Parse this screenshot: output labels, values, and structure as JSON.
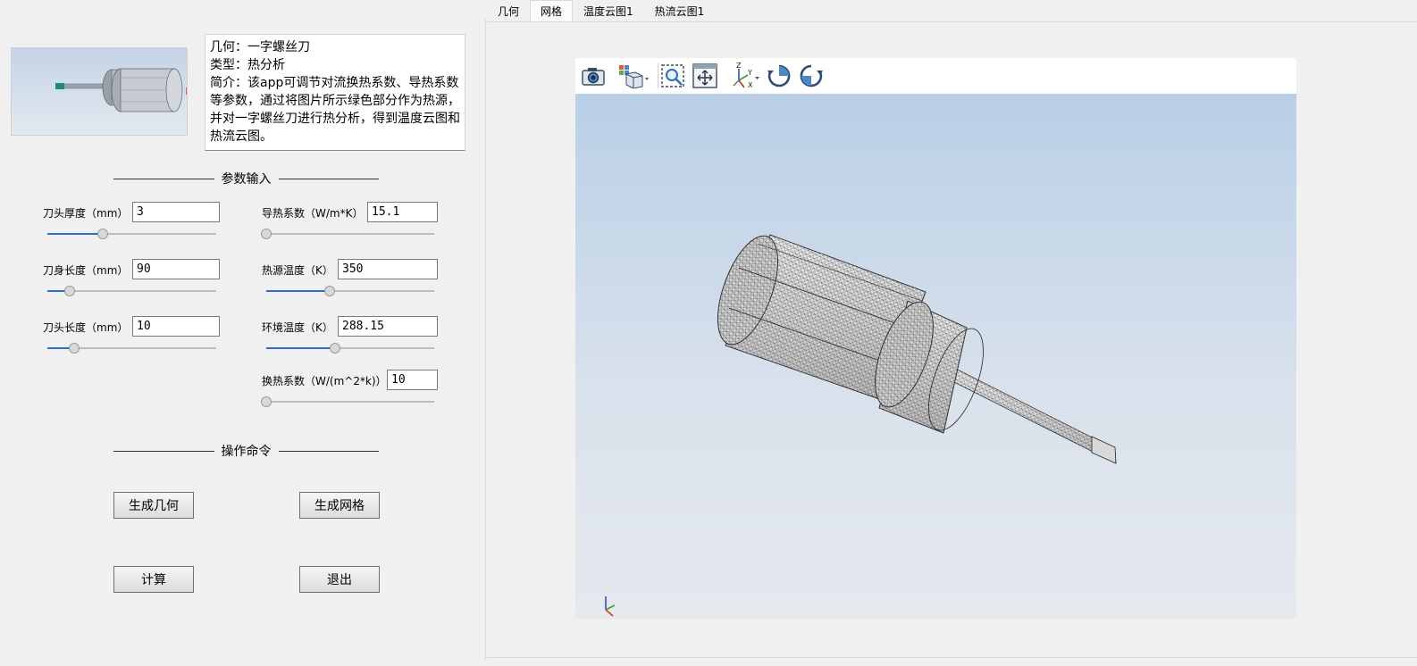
{
  "description": {
    "geometry": "几何：一字螺丝刀",
    "type": "类型：热分析",
    "intro": "简介：该app可调节对流换热系数、导热系数等参数，通过将图片所示绿色部分作为热源，并对一字螺丝刀进行热分析，得到温度云图和热流云图。"
  },
  "sections": {
    "param_input": "参数输入",
    "commands": "操作命令"
  },
  "params": {
    "head_thickness": {
      "label": "刀头厚度（mm）",
      "value": "3",
      "slider": 0.33
    },
    "body_length": {
      "label": "刀身长度（mm）",
      "value": "90",
      "slider": 0.13
    },
    "head_length": {
      "label": "刀头长度（mm）",
      "value": "10",
      "slider": 0.16
    },
    "conductivity": {
      "label": "导热系数（W/m*K）",
      "value": "15.1",
      "slider": 0.0
    },
    "source_temp": {
      "label": "热源温度（K）",
      "value": "350",
      "slider": 0.38
    },
    "ambient_temp": {
      "label": "环境温度（K）",
      "value": "288.15",
      "slider": 0.41
    },
    "htc": {
      "label": "换热系数（W/(m^2*k)）",
      "value": "10",
      "slider": 0.0
    }
  },
  "buttons": {
    "gen_geometry": "生成几何",
    "gen_mesh": "生成网格",
    "compute": "计算",
    "exit": "退出"
  },
  "tabs": [
    {
      "label": "几何",
      "active": false
    },
    {
      "label": "网格",
      "active": true
    },
    {
      "label": "温度云图1",
      "active": false
    },
    {
      "label": "热流云图1",
      "active": false
    }
  ],
  "toolbar_icons": [
    "camera-icon",
    "view-cube-icon",
    "zoom-extents-icon",
    "zoom-window-icon",
    "axis-orientation-icon",
    "rotate-clockwise-icon",
    "rotate-counterclockwise-icon"
  ],
  "axis_labels": {
    "z": "Z",
    "y": "Y",
    "x": "X"
  },
  "colors": {
    "accent": "#2f6ec4",
    "heat_source": "#1f8a7a"
  }
}
